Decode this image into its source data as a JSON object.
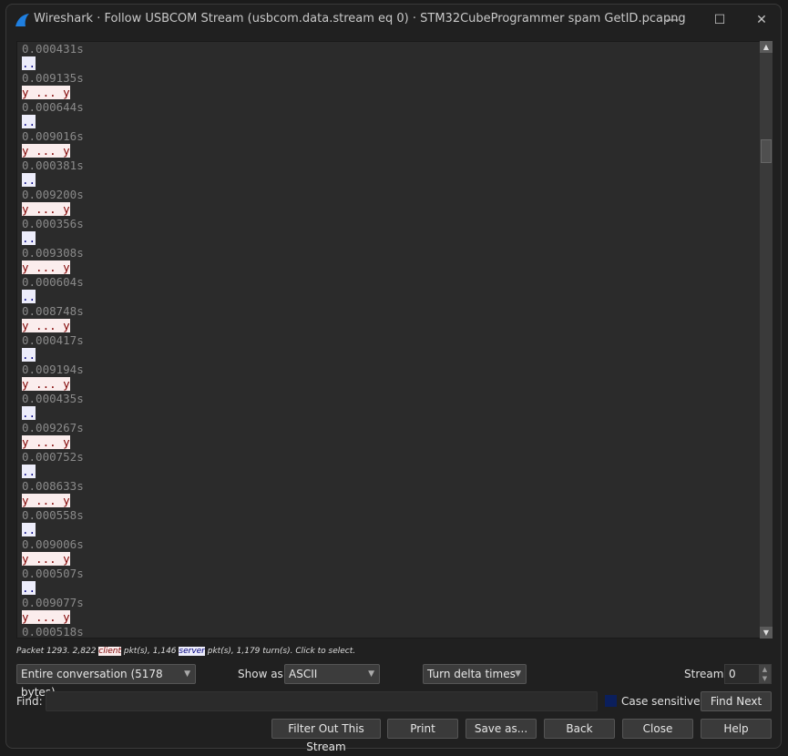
{
  "window": {
    "title": "Wireshark · Follow USBCOM Stream (usbcom.data.stream eq 0) · STM32CubeProgrammer spam GetID.pcapng",
    "minimize_icon": "minimize-icon",
    "maximize_icon": "maximize-icon",
    "close_icon": "close-icon"
  },
  "stream_lines": [
    {
      "type": "time",
      "text": "0.000431s"
    },
    {
      "type": "server",
      "text": ".."
    },
    {
      "type": "time",
      "text": "0.009135s"
    },
    {
      "type": "client",
      "text": "y ... y"
    },
    {
      "type": "time",
      "text": "0.000644s"
    },
    {
      "type": "server",
      "text": ".."
    },
    {
      "type": "time",
      "text": "0.009016s"
    },
    {
      "type": "client",
      "text": "y ... y"
    },
    {
      "type": "time",
      "text": "0.000381s"
    },
    {
      "type": "server",
      "text": ".."
    },
    {
      "type": "time",
      "text": "0.009200s"
    },
    {
      "type": "client",
      "text": "y ... y"
    },
    {
      "type": "time",
      "text": "0.000356s"
    },
    {
      "type": "server",
      "text": ".."
    },
    {
      "type": "time",
      "text": "0.009308s"
    },
    {
      "type": "client",
      "text": "y ... y"
    },
    {
      "type": "time",
      "text": "0.000604s"
    },
    {
      "type": "server",
      "text": ".."
    },
    {
      "type": "time",
      "text": "0.008748s"
    },
    {
      "type": "client",
      "text": "y ... y"
    },
    {
      "type": "time",
      "text": "0.000417s"
    },
    {
      "type": "server",
      "text": ".."
    },
    {
      "type": "time",
      "text": "0.009194s"
    },
    {
      "type": "client",
      "text": "y ... y"
    },
    {
      "type": "time",
      "text": "0.000435s"
    },
    {
      "type": "server",
      "text": ".."
    },
    {
      "type": "time",
      "text": "0.009267s"
    },
    {
      "type": "client",
      "text": "y ... y"
    },
    {
      "type": "time",
      "text": "0.000752s"
    },
    {
      "type": "server",
      "text": ".."
    },
    {
      "type": "time",
      "text": "0.008633s"
    },
    {
      "type": "client",
      "text": "y ... y"
    },
    {
      "type": "time",
      "text": "0.000558s"
    },
    {
      "type": "server",
      "text": ".."
    },
    {
      "type": "time",
      "text": "0.009006s"
    },
    {
      "type": "client",
      "text": "y ... y"
    },
    {
      "type": "time",
      "text": "0.000507s"
    },
    {
      "type": "server",
      "text": ".."
    },
    {
      "type": "time",
      "text": "0.009077s"
    },
    {
      "type": "client",
      "text": "y ... y"
    },
    {
      "type": "time",
      "text": "0.000518s"
    }
  ],
  "status": {
    "p1": "Packet 1293. 2,822 ",
    "client": "client",
    "p2": " pkt(s), 1,146 ",
    "server": "server",
    "p3": " pkt(s), 1,179 turn(s). Click to select."
  },
  "controls": {
    "conversation": "Entire conversation (5178 bytes)",
    "show_as_label": "Show as",
    "show_as": "ASCII",
    "time_mode": "Turn delta times",
    "stream_label": "Stream",
    "stream_value": "0",
    "find_label": "Find:",
    "find_value": "",
    "case_sensitive": "Case sensitive",
    "find_next": "Find Next"
  },
  "buttons": {
    "filter_out": "Filter Out This Stream",
    "print": "Print",
    "save_as": "Save as...",
    "back": "Back",
    "close": "Close",
    "help": "Help"
  },
  "colors": {
    "client_bg": "#fbeded",
    "client_fg": "#7f0000",
    "server_bg": "#ededfb",
    "server_fg": "#00007f",
    "checkbox": "#0b1f5c"
  }
}
